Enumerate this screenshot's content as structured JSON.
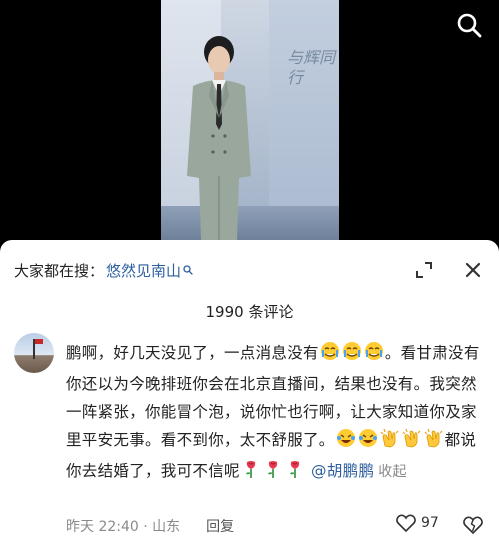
{
  "video": {
    "stage_logo_text": "与辉同行"
  },
  "comments_panel": {
    "trending_label": "大家都在搜：",
    "trending_term": "悠然见南山",
    "comment_count_text": "1990 条评论"
  },
  "comment": {
    "text_part1": "鹏啊，好几天没见了，一点消息没有",
    "text_part2": "。看甘肃没有你还以为今晚排班你会在北京直播间，结果也没有。我突然一阵紧张，你能冒个泡，说你忙也行啊，让大家知道你及家里平安无事。看不到你，太不舒服了。",
    "text_part3": "都说你去结婚了，我可不信呢",
    "mention": "@胡鹏鹏",
    "collapse_label": "收起",
    "timestamp": "昨天 22:40 · 山东",
    "reply_label": "回复",
    "like_count": "97"
  },
  "icons": {
    "search": "search-icon",
    "expand": "expand-icon",
    "close": "close-icon",
    "like": "heart-icon",
    "dislike": "broken-heart-icon",
    "emoji_cry": "crying-face-emoji",
    "emoji_laugh": "laugh-cry-emoji",
    "emoji_clap": "clapping-hands-emoji",
    "emoji_rose": "rose-emoji"
  },
  "colors": {
    "link_blue": "#2d5f9e",
    "meta_gray": "#8a8a8a"
  }
}
